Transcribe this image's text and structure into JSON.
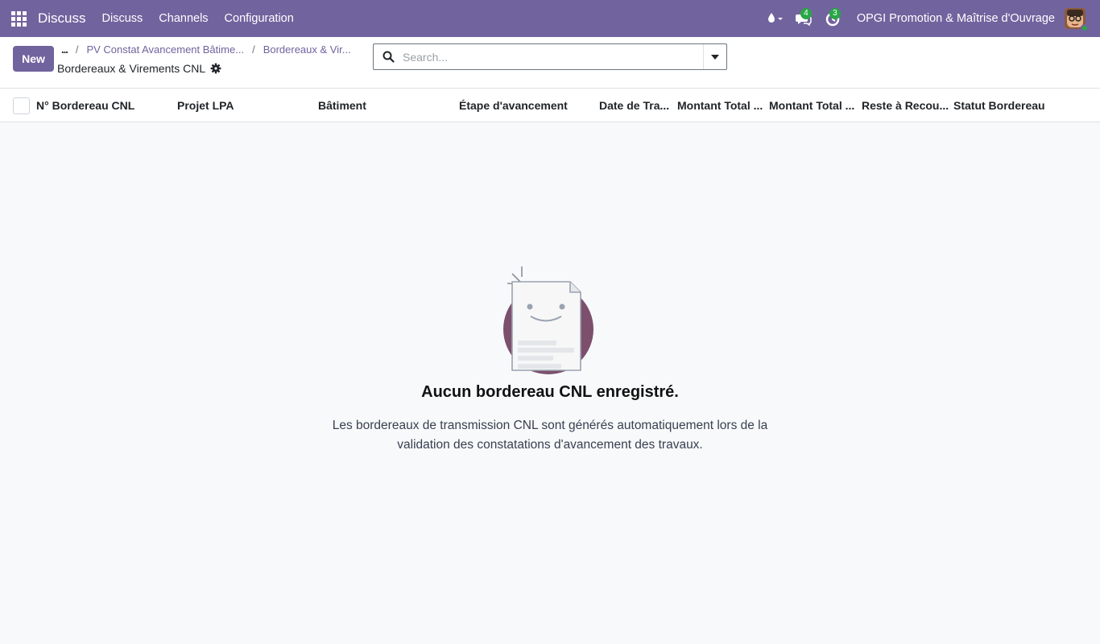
{
  "navbar": {
    "brand": "Discuss",
    "menu": [
      "Discuss",
      "Channels",
      "Configuration"
    ],
    "messages_count": "4",
    "activities_count": "3",
    "company": "OPGI Promotion & Maîtrise d'Ouvrage",
    "accent_color": "#71639e"
  },
  "control_panel": {
    "new_label": "New",
    "breadcrumb": {
      "ellipsis": "...",
      "separator": "/",
      "items": [
        "PV Constat Avancement Bâtime...",
        "Bordereaux & Vir..."
      ]
    },
    "current_title": "Bordereaux & Virements CNL",
    "search_placeholder": "Search..."
  },
  "list": {
    "columns": [
      "N° Bordereau CNL",
      "Projet LPA",
      "Bâtiment",
      "Étape d'avancement",
      "Date de Tra...",
      "Montant Total ...",
      "Montant Total ...",
      "Reste à Recou...",
      "Statut Bordereau"
    ]
  },
  "empty_state": {
    "title": "Aucun bordereau CNL enregistré.",
    "text": "Les bordereaux de transmission CNL sont générés automatiquement lors de la validation des constatations d'avancement des travaux."
  }
}
